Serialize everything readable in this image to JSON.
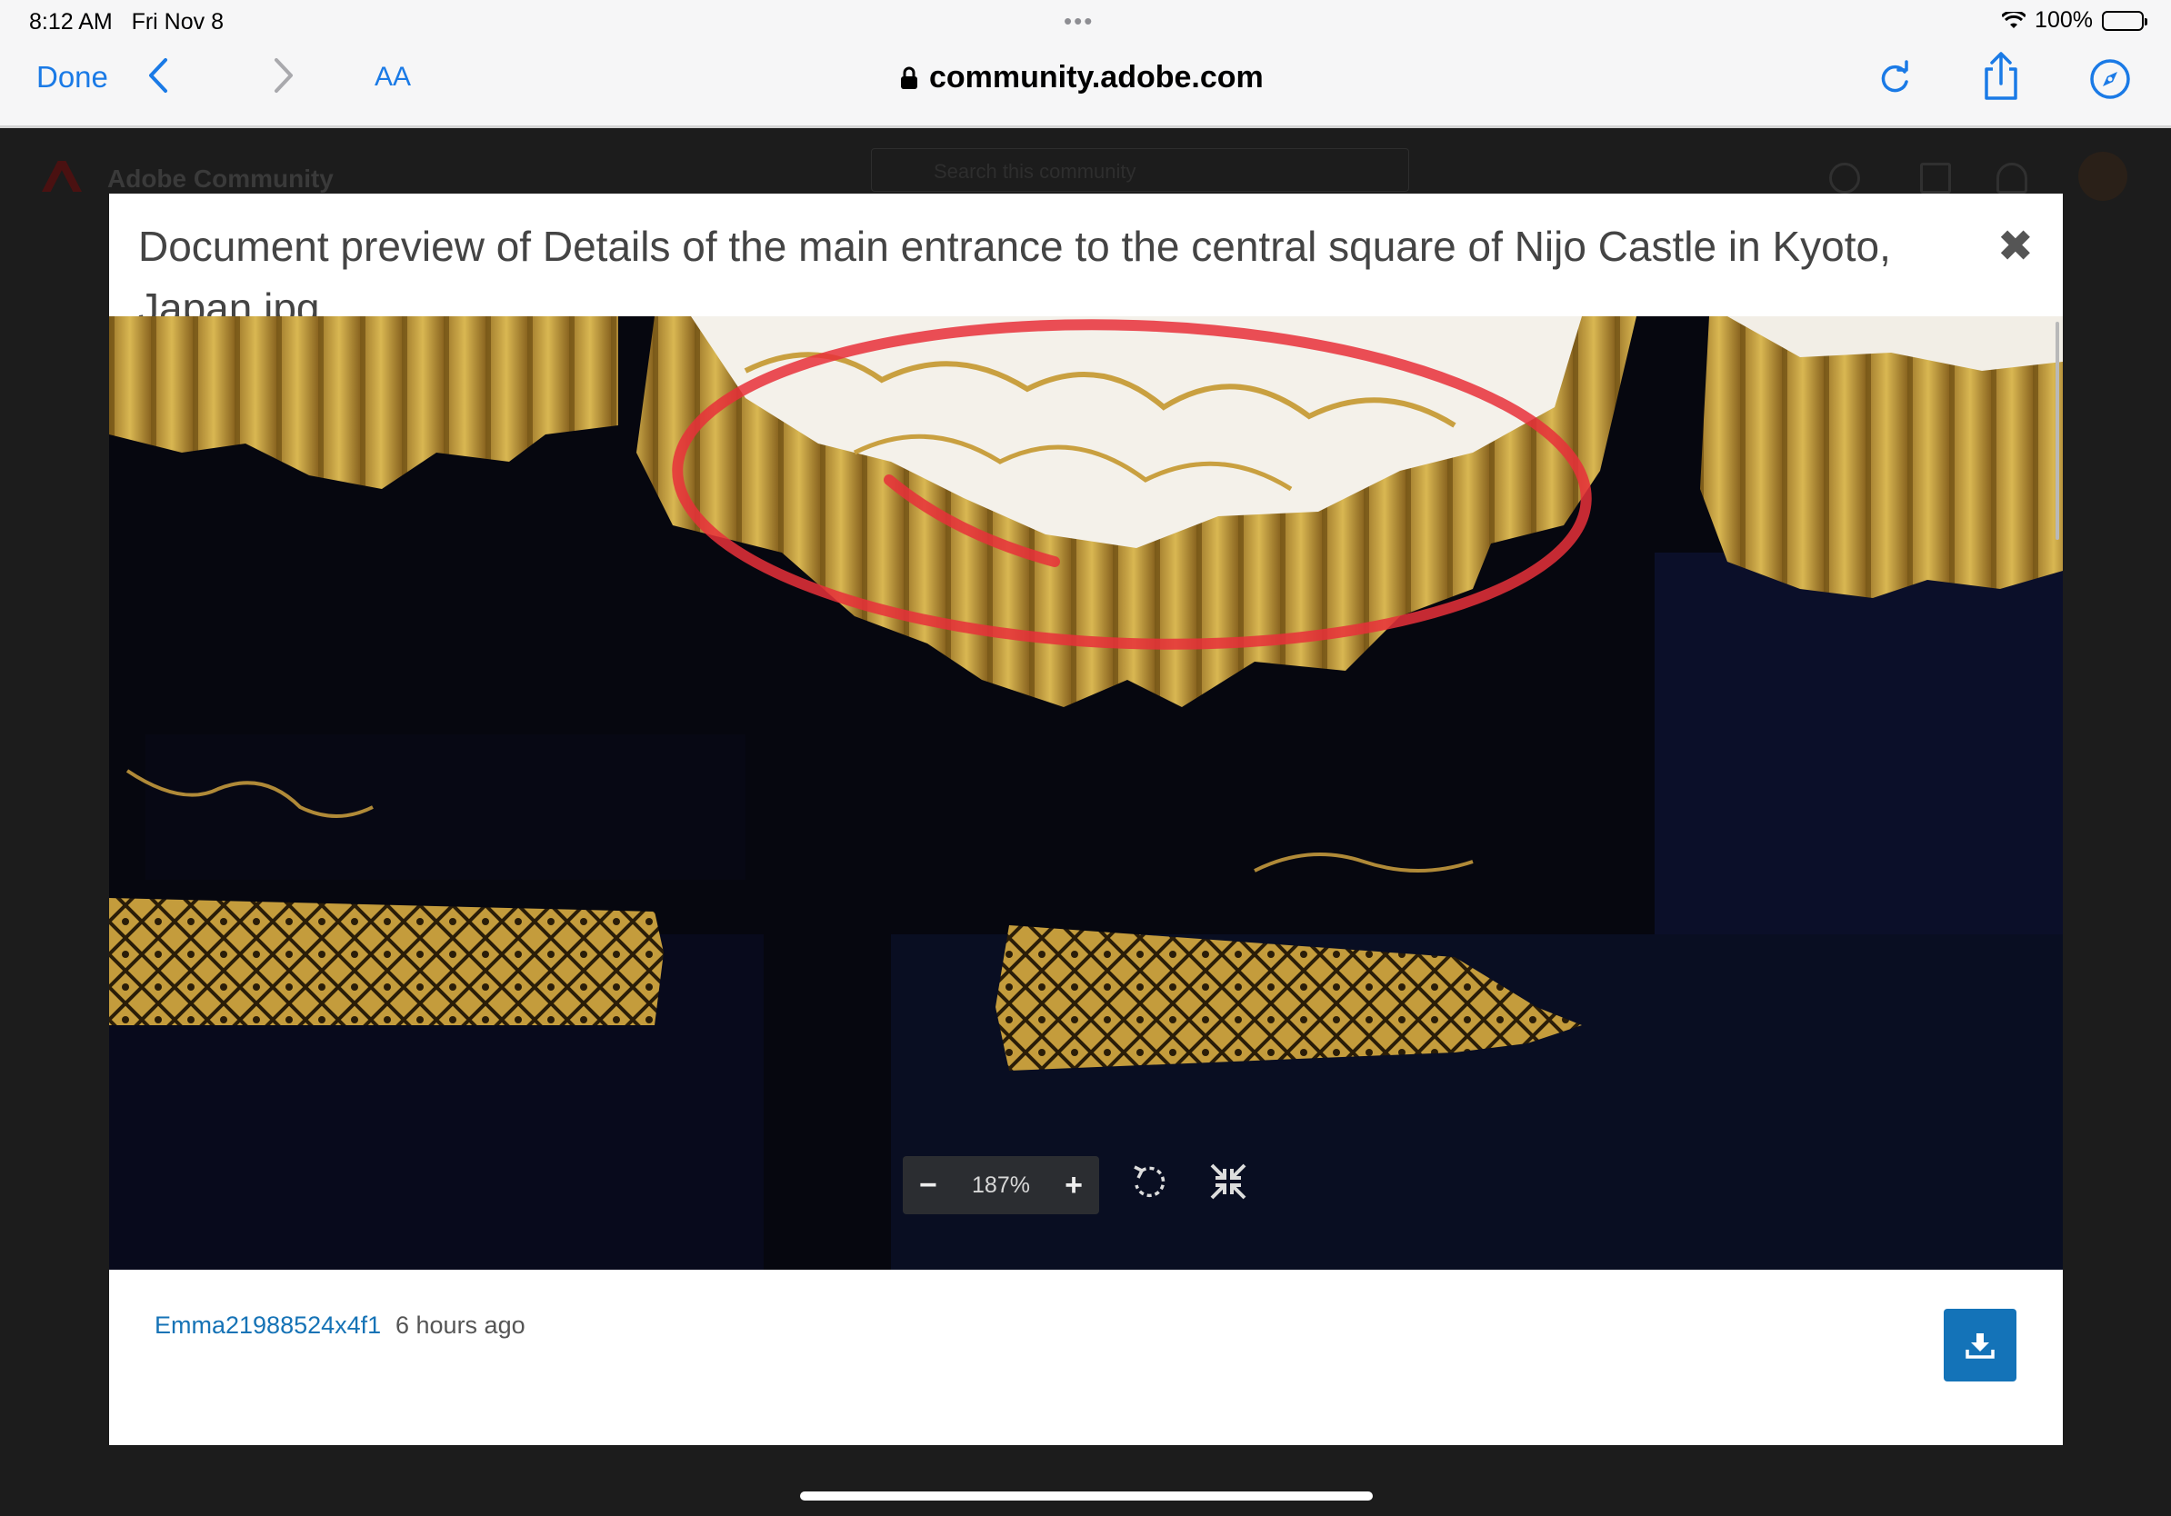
{
  "status_bar": {
    "time": "8:12 AM",
    "date": "Fri Nov 8",
    "battery": "100%"
  },
  "safari": {
    "done_label": "Done",
    "aa_label": "AA",
    "url": "community.adobe.com"
  },
  "adobe_header": {
    "title": "Adobe Community",
    "search_placeholder": "Search this community"
  },
  "modal": {
    "title": "Document preview of Details of the main entrance to the central square of Nijo Castle in Kyoto, Japan.jpg",
    "zoom_level": "187%",
    "zoom_out_label": "−",
    "zoom_in_label": "+",
    "author": "Emma21988524x4f1",
    "posted": "6 hours ago"
  },
  "colors": {
    "accent": "#1a7ae6",
    "link": "#1673b6",
    "download": "#1473b8",
    "annotation": "#e8303a",
    "gold": "#c9a040"
  }
}
